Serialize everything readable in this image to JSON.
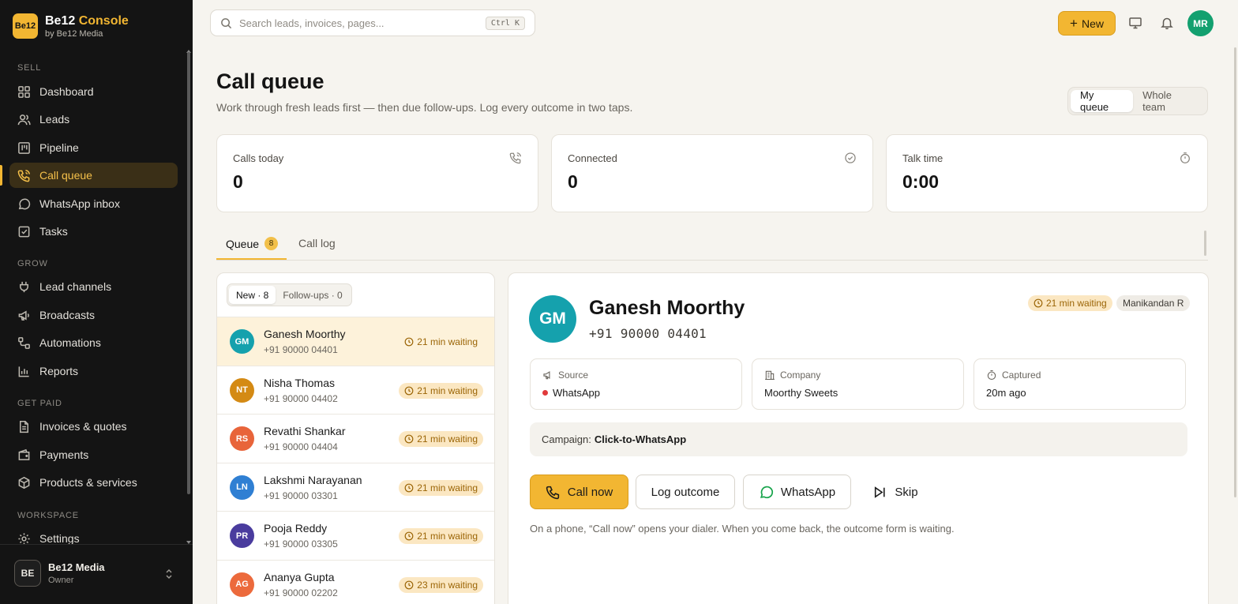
{
  "brand": {
    "logo_text": "Be12",
    "name_main": "Be12",
    "name_accent": "Console",
    "sub": "by Be12 Media"
  },
  "nav": {
    "sections": {
      "sell": "SELL",
      "grow": "GROW",
      "get_paid": "GET PAID",
      "workspace": "WORKSPACE"
    },
    "items": {
      "dashboard": "Dashboard",
      "leads": "Leads",
      "pipeline": "Pipeline",
      "call_queue": "Call queue",
      "whatsapp_inbox": "WhatsApp inbox",
      "tasks": "Tasks",
      "lead_channels": "Lead channels",
      "broadcasts": "Broadcasts",
      "automations": "Automations",
      "reports": "Reports",
      "invoices": "Invoices & quotes",
      "payments": "Payments",
      "products": "Products & services",
      "settings": "Settings"
    },
    "active": "call_queue"
  },
  "workspace": {
    "avatar": "BE",
    "name": "Be12 Media",
    "role": "Owner"
  },
  "topbar": {
    "search_placeholder": "Search leads, invoices, pages...",
    "shortcut": "Ctrl K",
    "new_label": "New",
    "user_initials": "MR"
  },
  "header": {
    "title": "Call queue",
    "subtitle": "Work through fresh leads first — then due follow-ups. Log every outcome in two taps.",
    "scope_options": [
      "My queue",
      "Whole team"
    ],
    "scope_selected": "My queue"
  },
  "stats": [
    {
      "label": "Calls today",
      "value": "0",
      "icon": "phone-call-icon"
    },
    {
      "label": "Connected",
      "value": "0",
      "icon": "check-circle-icon"
    },
    {
      "label": "Talk time",
      "value": "0:00",
      "icon": "timer-icon"
    }
  ],
  "tabs": {
    "queue": "Queue",
    "queue_count": "8",
    "call_log": "Call log"
  },
  "filters": {
    "new": "New · 8",
    "followups": "Follow-ups · 0"
  },
  "queue": [
    {
      "initials": "GM",
      "name": "Ganesh Moorthy",
      "phone": "+91 90000 04401",
      "wait": "21 min waiting",
      "color": "#15a1ad"
    },
    {
      "initials": "NT",
      "name": "Nisha Thomas",
      "phone": "+91 90000 04402",
      "wait": "21 min waiting",
      "color": "#d48a14"
    },
    {
      "initials": "RS",
      "name": "Revathi Shankar",
      "phone": "+91 90000 04404",
      "wait": "21 min waiting",
      "color": "#e8643a"
    },
    {
      "initials": "LN",
      "name": "Lakshmi Narayanan",
      "phone": "+91 90000 03301",
      "wait": "21 min waiting",
      "color": "#2f7fd3"
    },
    {
      "initials": "PR",
      "name": "Pooja Reddy",
      "phone": "+91 90000 03305",
      "wait": "21 min waiting",
      "color": "#4a3c9e"
    },
    {
      "initials": "AG",
      "name": "Ananya Gupta",
      "phone": "+91 90000 02202",
      "wait": "23 min waiting",
      "color": "#ec6a3c"
    }
  ],
  "detail": {
    "initials": "GM",
    "name": "Ganesh Moorthy",
    "phone": "+91 90000 04401",
    "wait": "21 min waiting",
    "owner": "Manikandan R",
    "source_label": "Source",
    "source_value": "WhatsApp",
    "company_label": "Company",
    "company_value": "Moorthy Sweets",
    "captured_label": "Captured",
    "captured_value": "20m ago",
    "campaign_label": "Campaign:",
    "campaign_value": "Click-to-WhatsApp",
    "actions": {
      "call": "Call now",
      "log": "Log outcome",
      "whatsapp": "WhatsApp",
      "skip": "Skip"
    },
    "note": "On a phone, “Call now” opens your dialer. When you come back, the outcome form is waiting."
  }
}
